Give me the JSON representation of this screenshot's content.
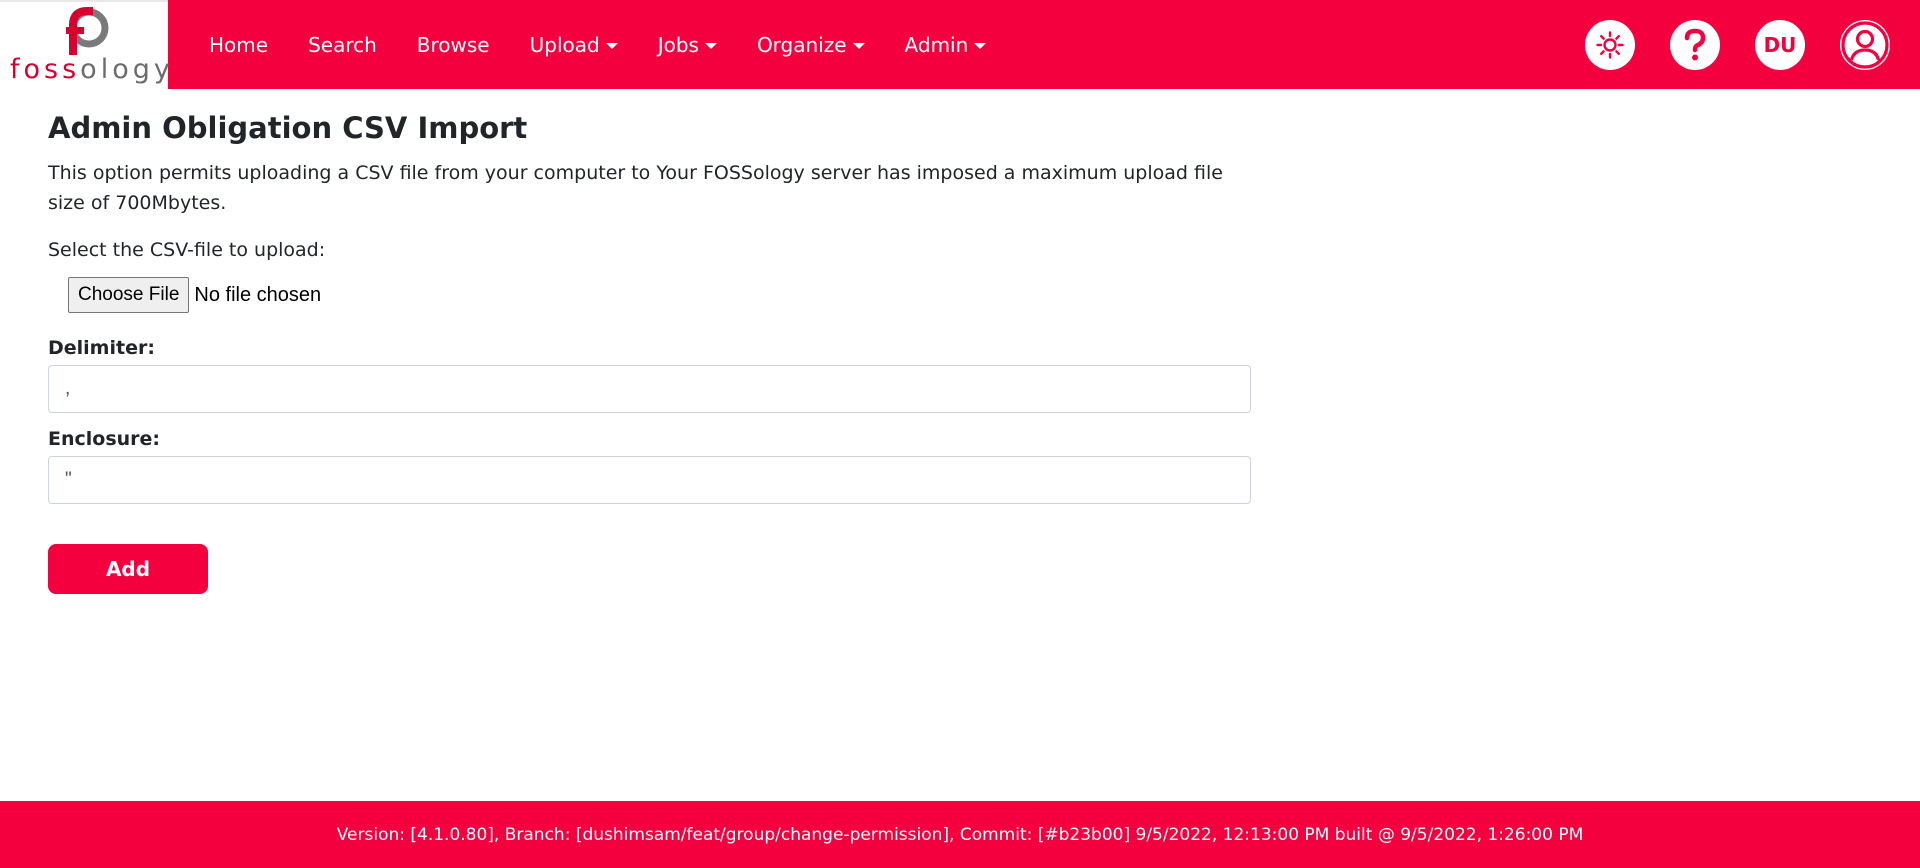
{
  "brand": {
    "logo_text_foss": "foss",
    "logo_text_ology": "ology",
    "primary_color": "#f5003e"
  },
  "nav": {
    "items": [
      {
        "label": "Home",
        "dropdown": false
      },
      {
        "label": "Search",
        "dropdown": false
      },
      {
        "label": "Browse",
        "dropdown": false
      },
      {
        "label": "Upload",
        "dropdown": true
      },
      {
        "label": "Jobs",
        "dropdown": true
      },
      {
        "label": "Organize",
        "dropdown": true
      },
      {
        "label": "Admin",
        "dropdown": true
      }
    ],
    "right": {
      "theme_icon": "sun-icon",
      "help_icon": "question-mark-icon",
      "user_initials": "DU",
      "profile_icon": "user-circle-icon"
    }
  },
  "main": {
    "title": "Admin Obligation CSV Import",
    "intro": "This option permits uploading a CSV file from your computer to Your FOSSology server has imposed a maximum upload file size of 700Mbytes.",
    "select_label": "Select the CSV-file to upload:",
    "file_button_label": "Choose File",
    "file_status": "No file chosen",
    "delimiter_label": "Delimiter:",
    "delimiter_value": ",",
    "enclosure_label": "Enclosure:",
    "enclosure_value": "\"",
    "add_label": "Add"
  },
  "footer": {
    "text": "Version: [4.1.0.80], Branch: [dushimsam/feat/group/change-permission], Commit: [#b23b00] 9/5/2022, 12:13:00 PM built @ 9/5/2022, 1:26:00 PM"
  }
}
